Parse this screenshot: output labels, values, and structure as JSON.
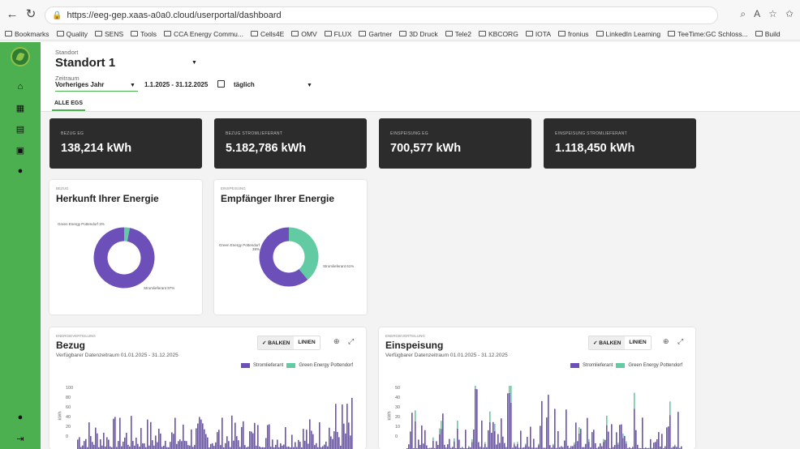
{
  "browser": {
    "url": "https://eeg-gep.xaas-a0a0.cloud/userportal/dashboard",
    "bookmarks": [
      "Bookmarks",
      "Quality",
      "SENS",
      "Tools",
      "CCA Energy Commu...",
      "Cells4E",
      "OMV",
      "FLUX",
      "Gartner",
      "3D Druck",
      "Tele2",
      "KBCORG",
      "IOTA",
      "fronius",
      "LinkedIn Learning",
      "TeeTime:GC Schloss...",
      "Build"
    ]
  },
  "header": {
    "standort_label": "Standort",
    "standort_value": "Standort 1",
    "zeitraum_label": "Zeitraum",
    "zeitraum_value": "Vorheriges Jahr",
    "range": "1.1.2025 - 31.12.2025",
    "interval": "täglich",
    "tab": "ALLE EGS"
  },
  "kpis": [
    {
      "title": "BEZUG EG",
      "value": "138,214 kWh"
    },
    {
      "title": "BEZUG STROMLIEFERANT",
      "value": "5.182,786 kWh"
    },
    {
      "title": "EINSPEISUNG EG",
      "value": "700,577 kWh"
    },
    {
      "title": "EINSPEISUNG STROMLIEFERANT",
      "value": "1.118,450 kWh"
    }
  ],
  "donuts": [
    {
      "sub": "BEZUG",
      "title": "Herkunft Ihrer Energie",
      "label_a": "Green Energy Pottendorf 3%",
      "label_b": "Stromlieferant 97%"
    },
    {
      "sub": "EINSPEISUNG",
      "title": "Empfänger Ihrer Energie",
      "label_a": "Green Energy Pottendorf 39%",
      "label_b": "Stromlieferant 61%"
    }
  ],
  "bars": [
    {
      "sub": "ENERGIEVERTEILUNG",
      "title": "Bezug",
      "range": "Verfügbarer Datenzeitraum 01.01.2025 - 31.12.2025",
      "btn_a": "✓ BALKEN",
      "btn_b": "LINIEN",
      "legend_a": "Stromlieferant",
      "legend_b": "Green Energy Pottendorf",
      "ylabel": "kWh",
      "yticks": [
        "100",
        "80",
        "60",
        "40",
        "20",
        "0"
      ]
    },
    {
      "sub": "ENERGIEVERTEILUNG",
      "title": "Einspeisung",
      "range": "Verfügbarer Datenzeitraum 01.01.2025 - 31.12.2025",
      "btn_a": "✓ BALKEN",
      "btn_b": "LINIEN",
      "legend_a": "Stromlieferant",
      "legend_b": "Green Energy Pottendorf",
      "ylabel": "kWh",
      "yticks": [
        "50",
        "40",
        "30",
        "20",
        "10",
        "0"
      ]
    }
  ],
  "chart_data": [
    {
      "type": "pie",
      "title": "Herkunft Ihrer Energie",
      "categories": [
        "Green Energy Pottendorf",
        "Stromlieferant"
      ],
      "values": [
        3,
        97
      ]
    },
    {
      "type": "pie",
      "title": "Empfänger Ihrer Energie",
      "categories": [
        "Green Energy Pottendorf",
        "Stromlieferant"
      ],
      "values": [
        39,
        61
      ]
    }
  ],
  "colors": {
    "green": "#4caf50",
    "purple": "#6c4fb8",
    "teal": "#63cba4",
    "dark_card": "#2c2c2c"
  }
}
